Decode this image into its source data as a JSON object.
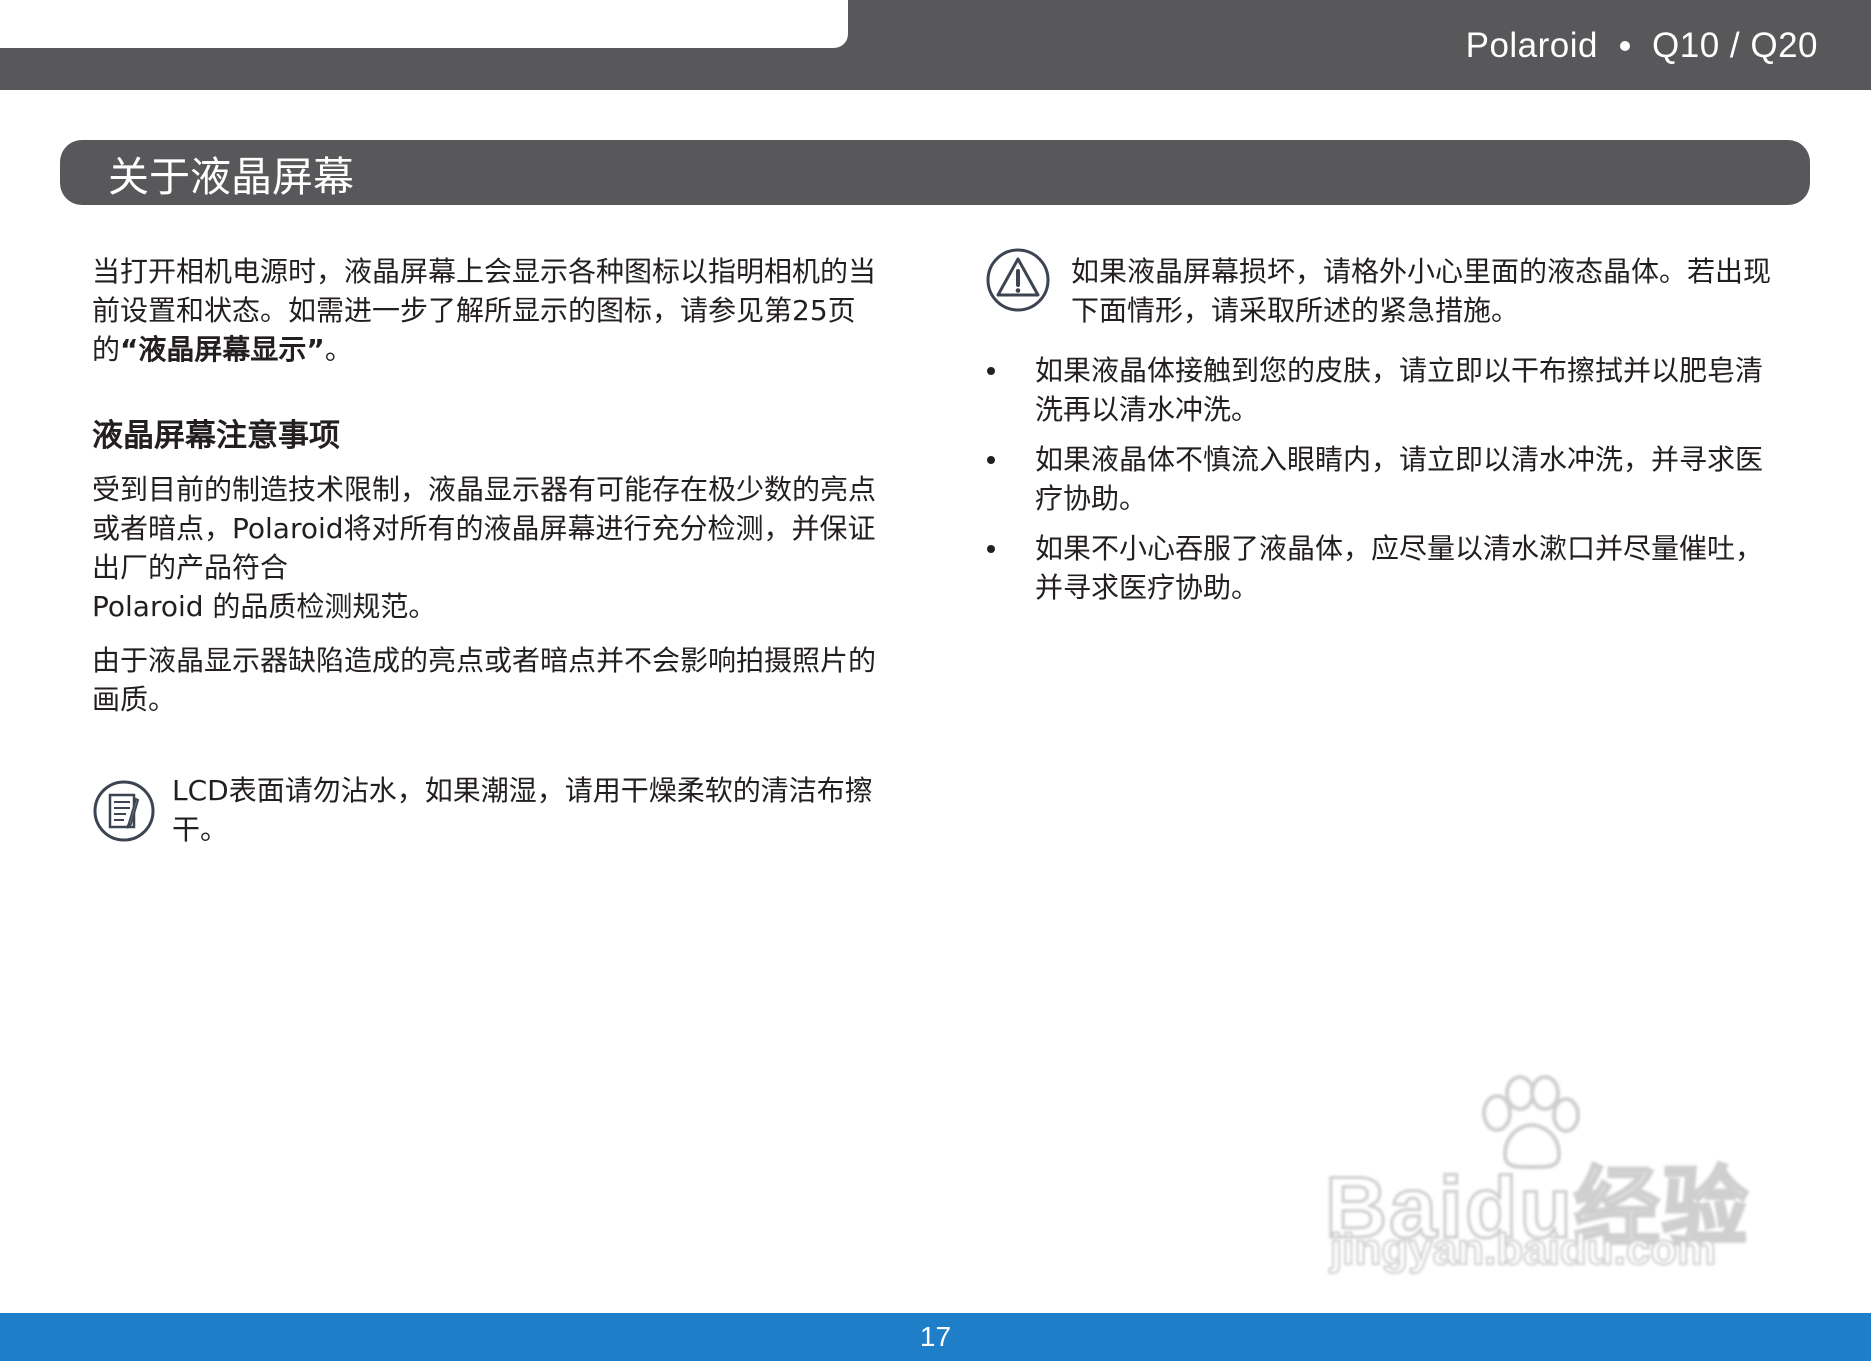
{
  "header": {
    "brand": "Polaroid",
    "model": "Q10 / Q20"
  },
  "section": {
    "title": "关于液晶屏幕"
  },
  "left": {
    "intro_before": "当打开相机电源时，液晶屏幕上会显示各种图标以指明相机的当前设置和状态。如需进一步了解所显示的图标，请参见第25页的",
    "intro_link": "“液晶屏幕显示”",
    "intro_after": "。",
    "subheading": "液晶屏幕注意事项",
    "para1": "受到目前的制造技术限制，液晶显示器有可能存在极少数的亮点或者暗点，Polaroid将对所有的液晶屏幕进行充分检测，并保证出厂的产品符合",
    "para1_line2": "Polaroid 的品质检测规范。",
    "para2": "由于液晶显示器缺陷造成的亮点或者暗点并不会影响拍摄照片的画质。",
    "note": "LCD表面请勿沾水，如果潮湿，请用干燥柔软的清洁布擦干。"
  },
  "right": {
    "warning": "如果液晶屏幕损坏，请格外小心里面的液态晶体。若出现下面情形，请采取所述的紧急措施。",
    "bullets": [
      "如果液晶体接触到您的皮肤，请立即以干布擦拭并以肥皂清洗再以清水冲洗。",
      "如果液晶体不慎流入眼睛内，请立即以清水冲洗，并寻求医疗协助。",
      "如果不小心吞服了液晶体，应尽量以清水漱口并尽量催吐，并寻求医疗协助。"
    ]
  },
  "footer": {
    "page_number": "17"
  },
  "watermark": {
    "brand": "Baidu经验",
    "url": "jingyan.baidu.com"
  },
  "icons": {
    "note": "note-icon",
    "warning": "warning-icon",
    "watermark": "paw-icon"
  },
  "colors": {
    "band": "#58585a",
    "footer": "#1e7ec8",
    "text": "#231f20"
  }
}
